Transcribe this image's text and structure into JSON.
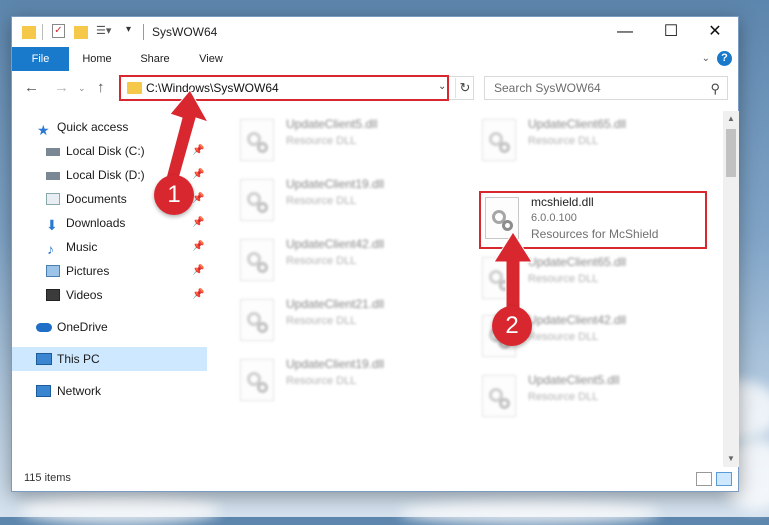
{
  "window": {
    "title": "SysWOW64",
    "minimize": "—",
    "maximize": "☐",
    "close": "✕"
  },
  "ribbon": {
    "tabs": [
      "File",
      "Home",
      "Share",
      "View"
    ],
    "help": "?"
  },
  "nav": {
    "back": "←",
    "forward": "→",
    "up": "↑",
    "address": "C:\\Windows\\SysWOW64",
    "search_placeholder": "Search SysWOW64"
  },
  "sidebar": {
    "items": [
      {
        "label": "Quick access",
        "icon": "star-icon"
      },
      {
        "label": "Local Disk (C:)",
        "icon": "drive-icon",
        "pinned": true
      },
      {
        "label": "Local Disk (D:)",
        "icon": "drive-icon",
        "pinned": true
      },
      {
        "label": "Documents",
        "icon": "documents-icon",
        "pinned": true
      },
      {
        "label": "Downloads",
        "icon": "downloads-icon",
        "pinned": true
      },
      {
        "label": "Music",
        "icon": "music-icon",
        "pinned": true
      },
      {
        "label": "Pictures",
        "icon": "pictures-icon",
        "pinned": true
      },
      {
        "label": "Videos",
        "icon": "videos-icon",
        "pinned": true
      },
      {
        "label": "OneDrive",
        "icon": "cloud-icon"
      },
      {
        "label": "This PC",
        "icon": "computer-icon",
        "selected": true
      },
      {
        "label": "Network",
        "icon": "network-icon"
      }
    ]
  },
  "files": {
    "left": [
      {
        "name": "UpdateClient5.dll",
        "type": "Resource DLL"
      },
      {
        "name": "UpdateClient19.dll",
        "type": "Resource DLL"
      },
      {
        "name": "UpdateClient42.dll",
        "type": "Resource DLL"
      },
      {
        "name": "UpdateClient21.dll",
        "type": "Resource DLL"
      },
      {
        "name": "UpdateClient19.dll",
        "type": "Resource DLL"
      }
    ],
    "right": [
      {
        "name": "UpdateClient65.dll",
        "type": "Resource DLL"
      },
      {
        "name": "UpdateClient65.dll",
        "type": "Resource DLL"
      },
      {
        "name": "UpdateClient42.dll",
        "type": "Resource DLL"
      },
      {
        "name": "UpdateClient5.dll",
        "type": "Resource DLL"
      }
    ],
    "highlighted": {
      "name": "mcshield.dll",
      "version": "6.0.0.100",
      "description": "Resources for McShield"
    }
  },
  "status": {
    "count": "115 items"
  },
  "annotations": {
    "step1": "1",
    "step2": "2",
    "highlight_color": "#d8272f"
  }
}
